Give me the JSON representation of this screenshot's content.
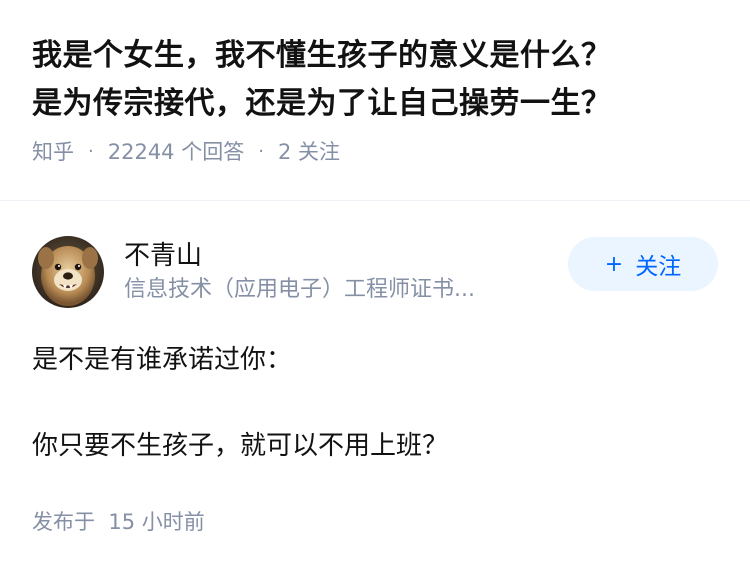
{
  "question": {
    "title_line1": "我是个女生，我不懂生孩子的意义是什么？",
    "title_line2": "是为传宗接代，还是为了让自己操劳一生？",
    "source": "知乎",
    "answers_count": "22244 个回答",
    "followers": "2 关注"
  },
  "answer": {
    "author": {
      "name": "不青山",
      "headline": "信息技术（应用电子）工程师证书...",
      "avatar_icon": "dog-avatar"
    },
    "follow_button": {
      "plus": "+",
      "label": "关注"
    },
    "content": {
      "line1": "是不是有谁承诺过你：",
      "line2": "你只要不生孩子，就可以不用上班？"
    },
    "publish_time": "发布于  15 小时前"
  },
  "colors": {
    "text": "#121212",
    "meta": "#8590a6",
    "accent": "#0066ff",
    "follow_bg": "#ebf5ff"
  }
}
